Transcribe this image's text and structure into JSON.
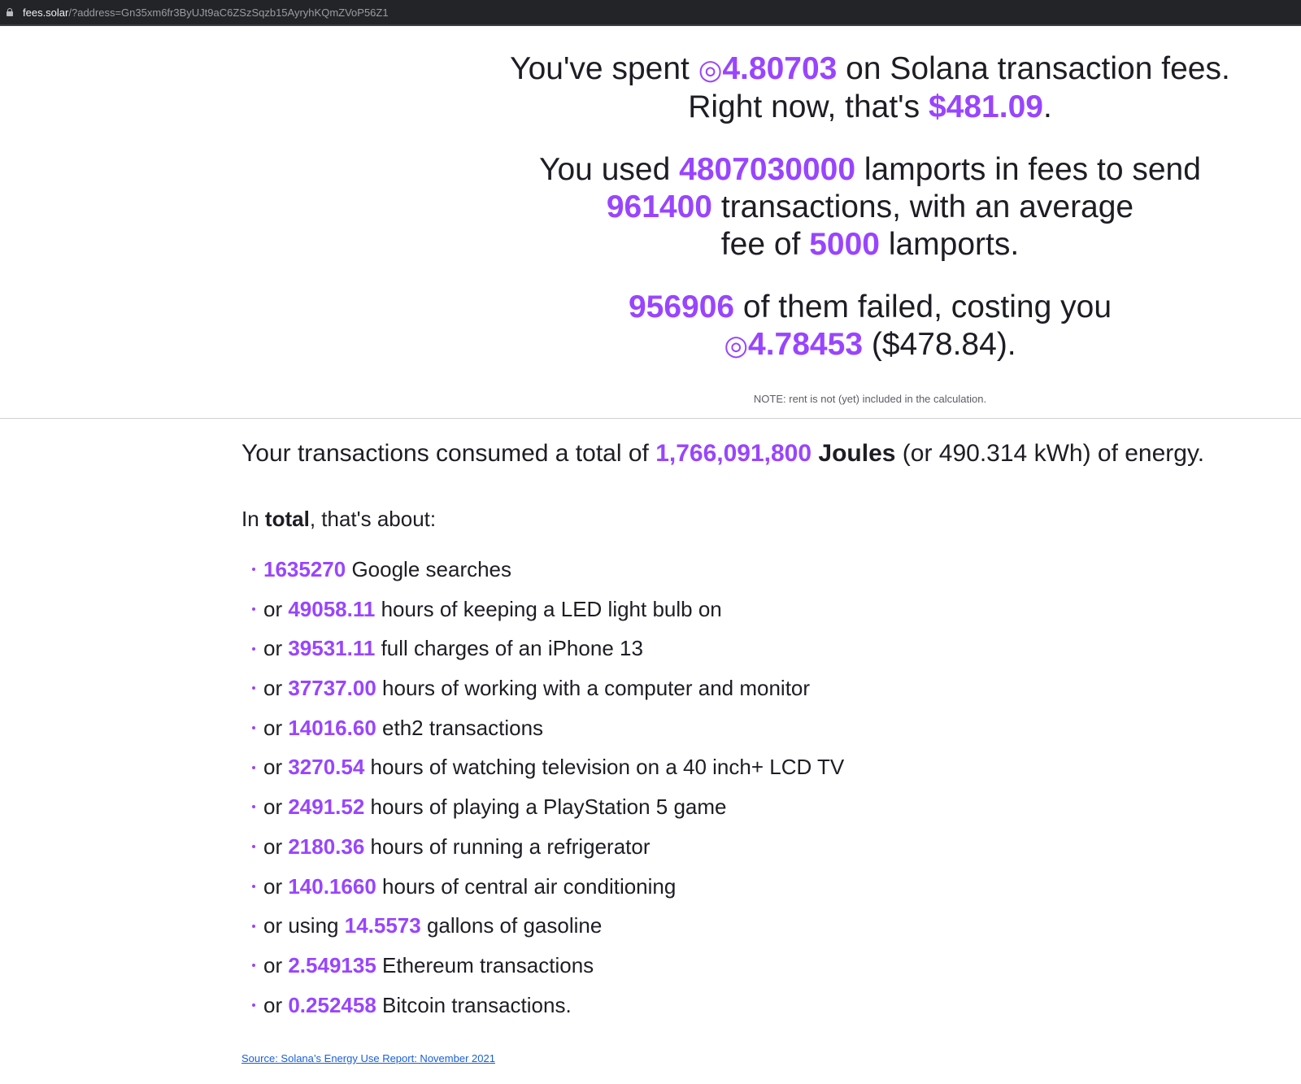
{
  "browser": {
    "url_host": "fees.solar",
    "url_rest": "/?address=Gn35xm6fr3ByUJt9aC6ZSzSqzb15AyryhKQmZVoP56Z1"
  },
  "summary": {
    "spent_prefix": "You've spent ",
    "sol_symbol": "◎",
    "spent_sol": "4.80703",
    "spent_suffix": " on Solana transaction fees.",
    "now_prefix": "Right now, that's ",
    "spent_usd": "$481.09",
    "now_suffix": ".",
    "used_prefix": "You used ",
    "lamports_total": "4807030000",
    "used_mid": " lamports in fees to send",
    "tx_count": "961400",
    "tx_mid": " transactions, with an average",
    "fee_prefix": "fee of ",
    "avg_fee": "5000",
    "fee_suffix": " lamports.",
    "failed_count": "956906",
    "failed_mid": " of them failed, costing you",
    "failed_sol": "4.78453",
    "failed_usd": " ($478.84).",
    "note": "NOTE: rent is not (yet) included in the calculation."
  },
  "energy": {
    "prefix": "Your transactions consumed a total of ",
    "joules": "1,766,091,800",
    "joules_unit": "Joules",
    "kwh": " (or 490.314 kWh) of energy."
  },
  "intro": {
    "prefix": "In ",
    "bold": "total",
    "suffix": ", that's about:"
  },
  "comparisons": [
    {
      "lead": "",
      "value": "1635270",
      "text": " Google searches"
    },
    {
      "lead": "or ",
      "value": "49058.11",
      "text": " hours of keeping a LED light bulb on"
    },
    {
      "lead": "or ",
      "value": "39531.11",
      "text": " full charges of an iPhone 13"
    },
    {
      "lead": "or ",
      "value": "37737.00",
      "text": " hours of working with a computer and monitor"
    },
    {
      "lead": "or ",
      "value": "14016.60",
      "text": " eth2 transactions"
    },
    {
      "lead": "or ",
      "value": "3270.54",
      "text": " hours of watching television on a 40 inch+ LCD TV"
    },
    {
      "lead": "or ",
      "value": "2491.52",
      "text": " hours of playing a PlayStation 5 game"
    },
    {
      "lead": "or ",
      "value": "2180.36",
      "text": " hours of running a refrigerator"
    },
    {
      "lead": "or ",
      "value": "140.1660",
      "text": " hours of central air conditioning"
    },
    {
      "lead": "or using ",
      "value": "14.5573",
      "text": " gallons of gasoline"
    },
    {
      "lead": "or ",
      "value": "2.549135",
      "text": " Ethereum transactions"
    },
    {
      "lead": "or ",
      "value": "0.252458",
      "text": " Bitcoin transactions."
    }
  ],
  "source_link": "Source: Solana’s Energy Use Report: November 2021",
  "colors": {
    "accent": "#9945ff",
    "text": "#1d1d24",
    "link": "#1a5fd6"
  }
}
